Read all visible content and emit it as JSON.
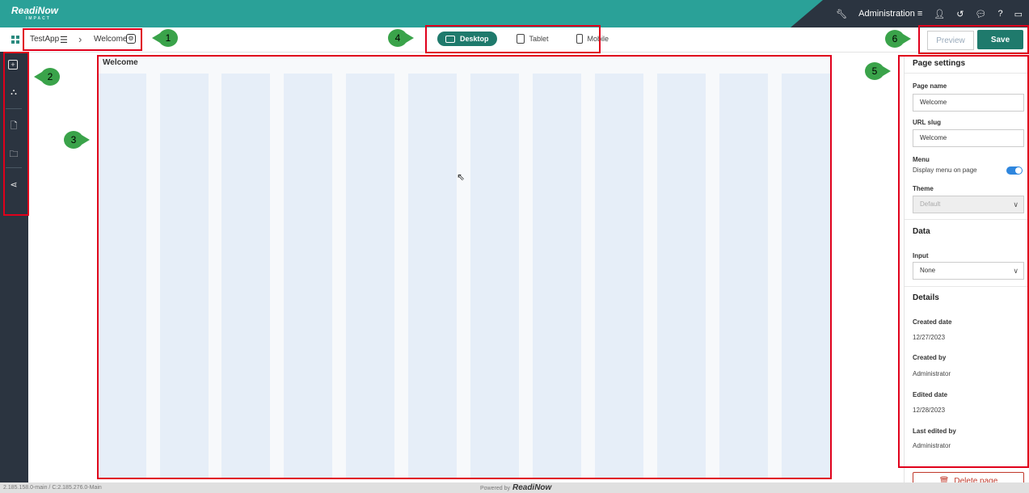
{
  "topbar": {
    "logo": "ReadiNow",
    "logo_sub": "IMPACT",
    "admin_label": "Administration",
    "accent": "#2aa198",
    "dark": "#2b3440"
  },
  "breadcrumb": {
    "app": "TestApp",
    "page": "Welcome"
  },
  "device_toggle": {
    "desktop": "Desktop",
    "tablet": "Tablet",
    "mobile": "Mobile"
  },
  "actions": {
    "preview": "Preview",
    "save": "Save"
  },
  "sidebar": {
    "items": [
      "add-page-icon",
      "hierarchy-icon",
      "document-icon",
      "folder-document-icon",
      "share-icon"
    ]
  },
  "canvas": {
    "title": "Welcome",
    "columns": 12
  },
  "page_settings": {
    "title": "Page settings",
    "page_name_label": "Page name",
    "page_name_value": "Welcome",
    "url_slug_label": "URL slug",
    "url_slug_value": "Welcome",
    "menu_label": "Menu",
    "menu_toggle_text": "Display menu on page",
    "menu_toggle_on": true,
    "theme_label": "Theme",
    "theme_value": "Default",
    "data_title": "Data",
    "input_label": "Input",
    "input_value": "None",
    "details_title": "Details",
    "created_date_label": "Created date",
    "created_date_value": "12/27/2023",
    "created_by_label": "Created by",
    "created_by_value": "Administrator",
    "edited_date_label": "Edited date",
    "edited_date_value": "12/28/2023",
    "last_edited_by_label": "Last edited by",
    "last_edited_by_value": "Administrator",
    "delete_label": "Delete page"
  },
  "footer": {
    "version": "2.185.158.0-main / C:2.185.276.0-Main",
    "powered_by": "Powered by",
    "brand": "ReadiNow"
  },
  "callouts": [
    "1",
    "2",
    "3",
    "4",
    "5",
    "6"
  ]
}
